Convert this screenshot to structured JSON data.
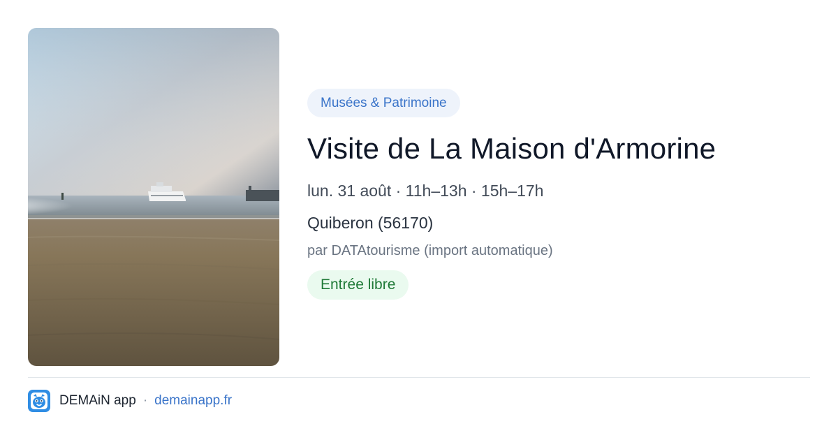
{
  "event": {
    "category": "Musées & Patrimoine",
    "title": "Visite de La Maison d'Armorine",
    "schedule": "lun. 31 août · 11h–13h · 15h–17h",
    "location": "Quiberon (56170)",
    "author": "par DATAtourisme (import automatique)",
    "price": "Entrée libre"
  },
  "footer": {
    "app_name": "DEMAiN app",
    "separator": "·",
    "link": "demainapp.fr"
  },
  "colors": {
    "category_chip_bg": "#eef3fb",
    "category_chip_text": "#3a74c9",
    "price_chip_bg": "#eafaef",
    "price_chip_text": "#1f7a37",
    "link": "#3a74c9",
    "logo": "#2f8de4"
  },
  "icons": {
    "logo": "demain-logo-icon",
    "photo": "beach-ferry-photo"
  }
}
